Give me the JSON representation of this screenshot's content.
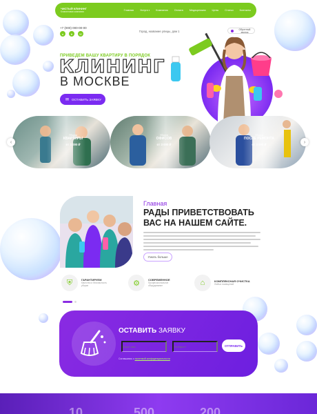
{
  "header": {
    "logo_title": "ЧИСТЫЙ КЛИНИНГ",
    "logo_sub": "Клининговая компания",
    "nav": [
      "Главная",
      "Услуги",
      "Прайс-лист",
      "Отзывы",
      "Новости",
      "Вакансии",
      "Контакты",
      "Блог"
    ],
    "nav_short": [
      "Главная",
      "Услуги",
      "Компания",
      "Оплата",
      "Медицинская",
      "Цены",
      "Статьи"
    ],
    "nav_last": "Контакты"
  },
  "contacts": {
    "phone": "+7 (000) 000-00-00",
    "address": "Город, название улицы, дом 1",
    "callback": "Обратный звонок"
  },
  "hero": {
    "tag": "ПРИВЕДЕМ ВАШУ КВАРТИРУ В ПОРЯДОК",
    "title": "КЛИНИНГ",
    "city": "В МОСКВЕ",
    "cta": "ОСТАВИТЬ ЗАЯВКУ"
  },
  "slides": [
    {
      "pre": "Уборка",
      "name": "КВАРТИРЫ",
      "price": "от 3 000 ₽"
    },
    {
      "pre": "Уборка",
      "name": "ОФИСОВ",
      "price": "от 3 000 ₽"
    },
    {
      "pre": "Уборка",
      "name": "ПОСЛЕ РЕМОНТА",
      "price": "от 3 000 ₽"
    }
  ],
  "about": {
    "label": "Главная",
    "title": "РАДЫ ПРИВЕТСТВОВАТЬ ВАС НА НАШЕМ САЙТЕ.",
    "more": "Узнать больше"
  },
  "features": [
    {
      "icon": "shield-icon",
      "title": "ГАРАНТИРУЕМ",
      "sub": "Качество и безопасность уборки"
    },
    {
      "icon": "vacuum-icon",
      "title": "СОВРЕМЕННОЕ",
      "sub": "Профессиональное оборудование"
    },
    {
      "icon": "house-icon",
      "title": "КОМПЛЕКСНАЯ ОЧИСТКА",
      "sub": "Любых помещений"
    }
  ],
  "request": {
    "title_bold": "ОСТАВИТЬ",
    "title_rest": "ЗАЯВКУ",
    "name_placeholder": "Ваше имя",
    "phone_placeholder": "Телефон*",
    "submit": "ОТПРАВИТЬ",
    "agree_prefix": "Соглашаюсь с",
    "agree_link": "политикой конфиденциальности"
  },
  "stats": [
    "10",
    "500",
    "200"
  ],
  "colors": {
    "green": "#7ccb1f",
    "purple": "#7b2bf1"
  }
}
